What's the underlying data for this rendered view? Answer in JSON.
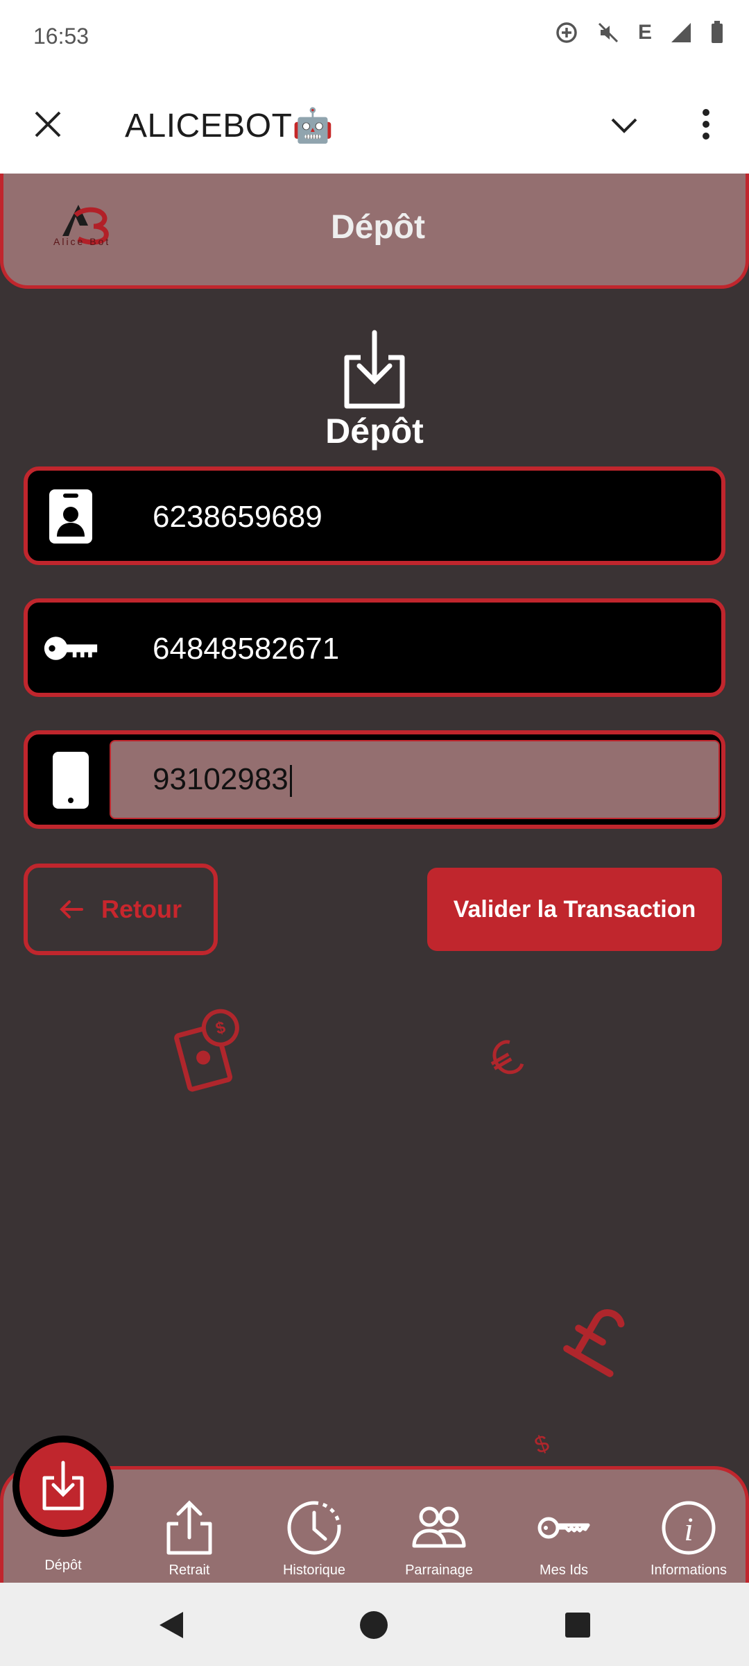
{
  "status_bar": {
    "time": "16:53",
    "network": "E"
  },
  "app_bar": {
    "title": "ALICEBOT🤖"
  },
  "header": {
    "logo_text": "Alice Bot",
    "title": "Dépôt"
  },
  "hero": {
    "title": "Dépôt"
  },
  "form": {
    "id_value": "6238659689",
    "key_value": "64848582671",
    "phone_value": "93102983"
  },
  "buttons": {
    "back": "Retour",
    "validate": "Valider la Transaction"
  },
  "bottom_nav": {
    "items": [
      {
        "label": "Dépôt",
        "icon": "download-icon"
      },
      {
        "label": "Retrait",
        "icon": "upload-icon"
      },
      {
        "label": "Historique",
        "icon": "clock-icon"
      },
      {
        "label": "Parrainage",
        "icon": "users-icon"
      },
      {
        "label": "Mes Ids",
        "icon": "key-icon"
      },
      {
        "label": "Informations",
        "icon": "info-icon"
      }
    ]
  },
  "colors": {
    "accent": "#c0262d",
    "header_bg": "#946f70",
    "body_bg": "#3a3334"
  }
}
